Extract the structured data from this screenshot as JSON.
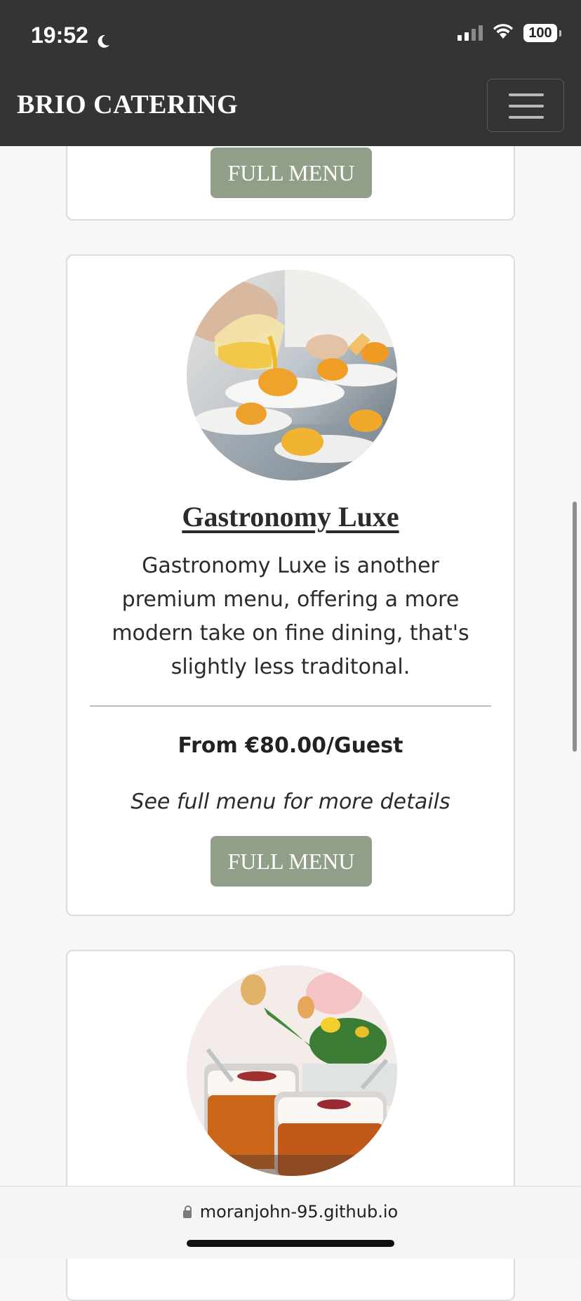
{
  "status_bar": {
    "time": "19:52",
    "battery": "100"
  },
  "navbar": {
    "brand": "BRIO CATERING"
  },
  "cards": [
    {
      "button_label": "FULL MENU"
    },
    {
      "image": "pumpkin-soup-plating-photo",
      "title": "Gastronomy Luxe",
      "description": "Gastronomy Luxe is another premium menu, offering a more modern take on fine dining, that's slightly less traditonal.",
      "price": "From €80.00/Guest",
      "note": "See full menu for more details",
      "button_label": "FULL MENU"
    },
    {
      "image": "cocktail-drinks-photo"
    }
  ],
  "browser": {
    "url": "moranjohn-95.github.io"
  },
  "icons": {
    "moon": "moon-icon",
    "signal": "cellular-signal-icon",
    "wifi": "wifi-icon",
    "battery": "battery-icon",
    "menu": "hamburger-menu-icon",
    "lock": "lock-icon"
  },
  "colors": {
    "navbar_bg": "#343434",
    "button_bg": "#919e88",
    "page_bg": "#f8f7f5"
  }
}
